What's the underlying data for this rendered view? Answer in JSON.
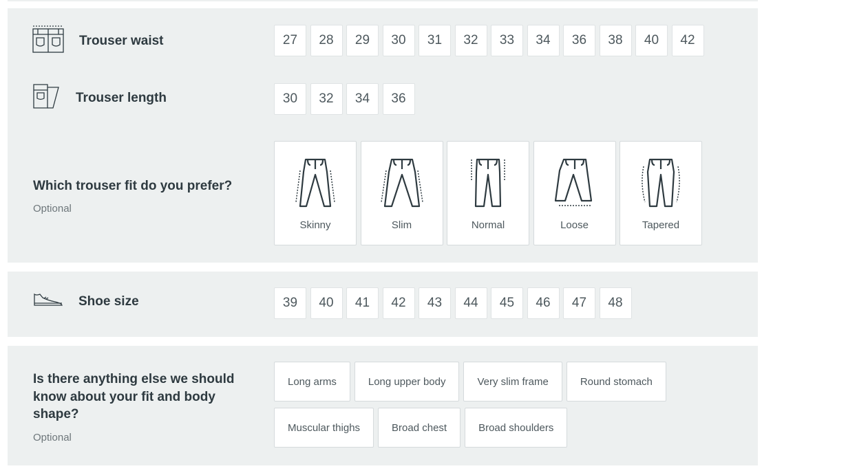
{
  "trouser_waist": {
    "label": "Trouser waist",
    "icon": "trouser-waist-icon",
    "sizes": [
      "27",
      "28",
      "29",
      "30",
      "31",
      "32",
      "33",
      "34",
      "36",
      "38",
      "40",
      "42"
    ]
  },
  "trouser_length": {
    "label": "Trouser length",
    "icon": "trouser-length-icon",
    "sizes": [
      "30",
      "32",
      "34",
      "36"
    ]
  },
  "trouser_fit": {
    "question": "Which trouser fit do you prefer?",
    "optional": "Optional",
    "options": [
      {
        "label": "Skinny",
        "icon": "skinny-fit-icon"
      },
      {
        "label": "Slim",
        "icon": "slim-fit-icon"
      },
      {
        "label": "Normal",
        "icon": "normal-fit-icon"
      },
      {
        "label": "Loose",
        "icon": "loose-fit-icon"
      },
      {
        "label": "Tapered",
        "icon": "tapered-fit-icon"
      }
    ]
  },
  "shoe_size": {
    "label": "Shoe size",
    "icon": "shoe-icon",
    "sizes": [
      "39",
      "40",
      "41",
      "42",
      "43",
      "44",
      "45",
      "46",
      "47",
      "48"
    ]
  },
  "body_shape": {
    "question_lines": [
      "Is there anything else we should",
      "know about your fit and body",
      "shape?"
    ],
    "optional": "Optional",
    "options_row1": [
      "Long arms",
      "Long upper body",
      "Very slim frame",
      "Round stomach"
    ],
    "options_row2": [
      "Muscular thighs",
      "Broad chest",
      "Broad shoulders"
    ]
  },
  "colors": {
    "panel_bg": "#edf0f0",
    "chip_border": "#dfe3e4",
    "text_dark": "#2e3a40",
    "text_muted": "#6d767a"
  }
}
